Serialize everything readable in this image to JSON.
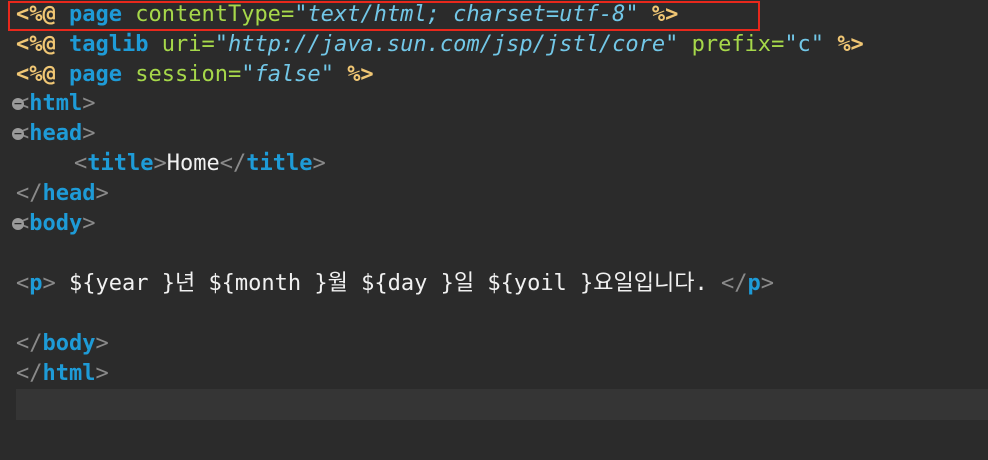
{
  "lines": {
    "l1": {
      "open": "<%@",
      "kw": "page",
      "attr": "contentType",
      "eq": "=",
      "q1": "\"",
      "val": "text/html; charset=utf-8",
      "q2": "\"",
      "close": "%>"
    },
    "l2": {
      "open": "<%@",
      "kw": "taglib",
      "attr1": "uri",
      "eq1": "=",
      "q1": "\"",
      "val1": "http://java.sun.com/jsp/jstl/core",
      "q2": "\"",
      "attr2": "prefix",
      "eq2": "=",
      "val2": "\"c\"",
      "close": "%>"
    },
    "l3": {
      "open": "<%@",
      "kw": "page",
      "attr": "session",
      "eq": "=",
      "q1": "\"",
      "val": "false",
      "q2": "\"",
      "close": "%>"
    },
    "l4": {
      "lt": "<",
      "tag": "html",
      "gt": ">"
    },
    "l5": {
      "lt": "<",
      "tag": "head",
      "gt": ">"
    },
    "l6": {
      "lt1": "<",
      "tag1": "title",
      "gt1": ">",
      "text": "Home",
      "lt2": "</",
      "tag2": "title",
      "gt2": ">"
    },
    "l7": {
      "lt": "</",
      "tag": "head",
      "gt": ">"
    },
    "l8": {
      "lt": "<",
      "tag": "body",
      "gt": ">"
    },
    "l10": {
      "lt1": "<",
      "tag1": "p",
      "gt1": ">",
      "text": " ${year }년 ${month }월 ${day }일 ${yoil }요일입니다. ",
      "lt2": "</",
      "tag2": "p",
      "gt2": ">"
    },
    "l12": {
      "lt": "</",
      "tag": "body",
      "gt": ">"
    },
    "l13": {
      "lt": "</",
      "tag": "html",
      "gt": ">"
    }
  },
  "fold_marker": "−"
}
